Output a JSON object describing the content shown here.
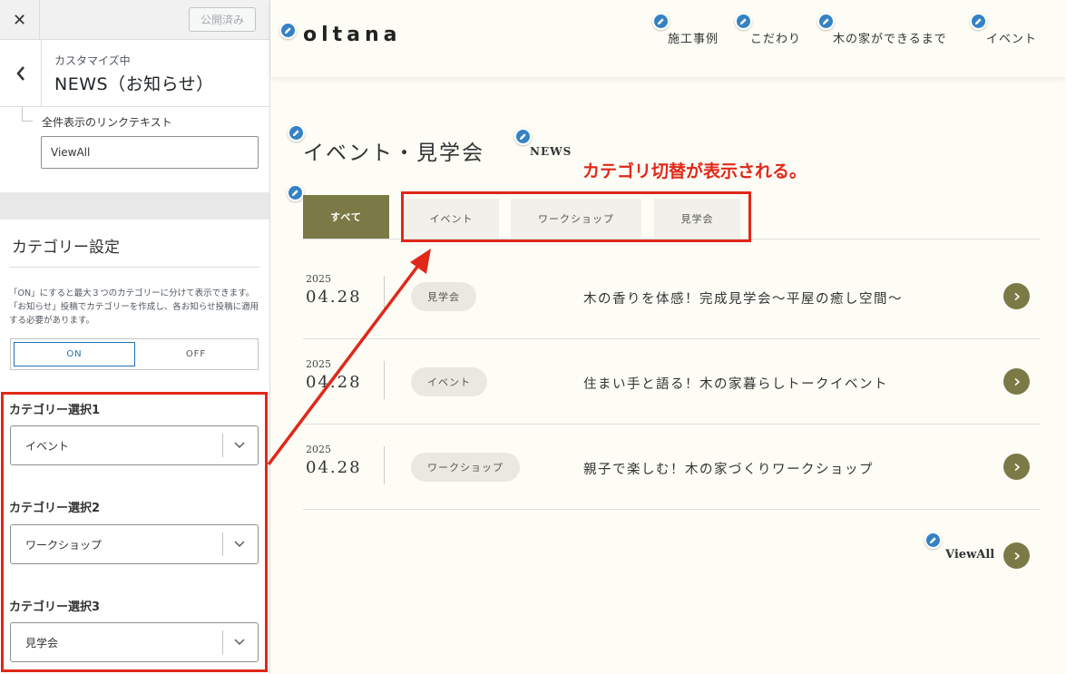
{
  "customizer": {
    "close_icon_glyph": "✕",
    "publish_label": "公開済み",
    "back_icon_glyph": "‹",
    "breadcrumb": "カスタマイズ中",
    "section_title": "NEWS（お知らせ）",
    "link_text_label": "全件表示のリンクテキスト",
    "link_text_value": "ViewAll",
    "category_settings_title": "カテゴリー設定",
    "category_description": "「ON」にすると最大３つのカテゴリーに分けて表示できます。「お知らせ」投稿でカテゴリーを作成し、各お知らせ投稿に適用する必要があります。",
    "toggle_on": "ON",
    "toggle_off": "OFF",
    "selects": [
      {
        "label": "カテゴリー選択1",
        "value": "イベント"
      },
      {
        "label": "カテゴリー選択2",
        "value": "ワークショップ"
      },
      {
        "label": "カテゴリー選択3",
        "value": "見学会"
      }
    ]
  },
  "site": {
    "logo": "oltana",
    "nav": [
      "施工事例",
      "こだわり",
      "木の家ができるまで",
      "イベント"
    ],
    "heading": "イベント・見学会",
    "heading_en": "NEWS",
    "annotation": "カテゴリ切替が表示される。",
    "tabs": [
      "すべて",
      "イベント",
      "ワークショップ",
      "見学会"
    ],
    "news": [
      {
        "year": "2025",
        "date": "04.28",
        "category": "見学会",
        "title": "木の香りを体感！完成見学会〜平屋の癒し空間〜"
      },
      {
        "year": "2025",
        "date": "04.28",
        "category": "イベント",
        "title": "住まい手と語る！木の家暮らしトークイベント"
      },
      {
        "year": "2025",
        "date": "04.28",
        "category": "ワークショップ",
        "title": "親子で楽しむ！木の家づくりワークショップ"
      }
    ],
    "viewall_label": "ViewAll"
  },
  "colors": {
    "accent_olive": "#7b7a47",
    "annotation_red": "#e0281a",
    "edit_pencil_blue": "#3582c4",
    "toggle_blue": "#2271b1"
  },
  "icons": {
    "close": "close-icon",
    "back": "chevron-left-icon",
    "dropdown": "chevron-down-icon",
    "edit": "pencil-icon",
    "arrow": "arrow-right-icon"
  }
}
